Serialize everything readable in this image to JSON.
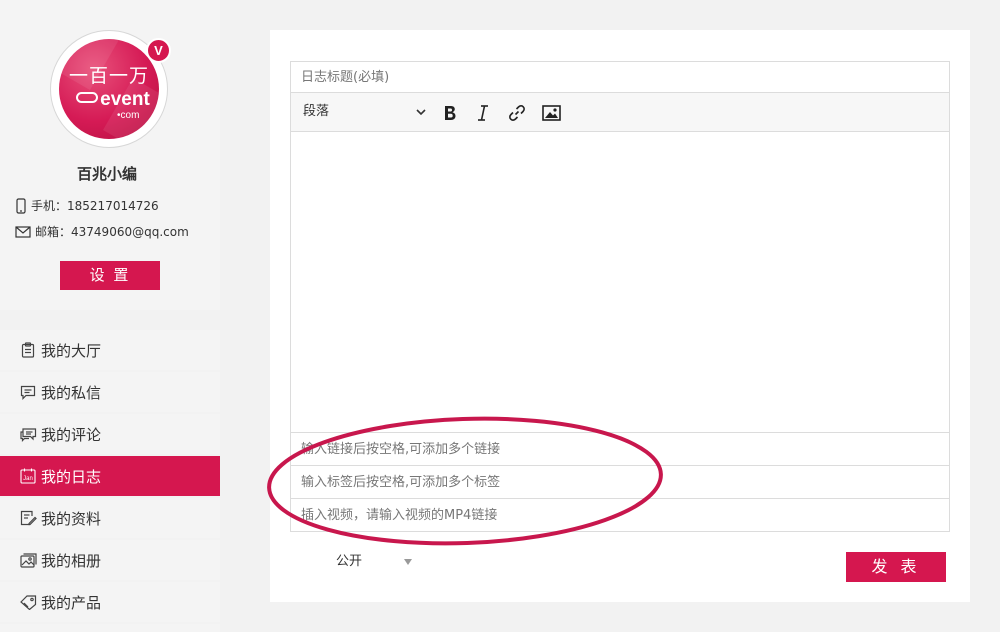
{
  "profile": {
    "logo_cn": "一百一万",
    "logo_event": "event",
    "logo_com": "•com",
    "badge": "V",
    "username": "百兆小编",
    "phone_label": "手机：",
    "phone": "185217014726",
    "email_label": "邮箱：",
    "email": "43749060@qq.com",
    "settings_label": "设 置"
  },
  "nav": {
    "items": [
      {
        "label": "我的大厅",
        "icon": "clipboard-icon"
      },
      {
        "label": "我的私信",
        "icon": "message-icon"
      },
      {
        "label": "我的评论",
        "icon": "comment-icon"
      },
      {
        "label": "我的日志",
        "icon": "calendar-icon",
        "icon_text": "Jan",
        "active": true
      },
      {
        "label": "我的资料",
        "icon": "profile-edit-icon"
      },
      {
        "label": "我的相册",
        "icon": "album-icon"
      },
      {
        "label": "我的产品",
        "icon": "product-tag-icon"
      }
    ]
  },
  "editor": {
    "title_placeholder": "日志标题(必填)",
    "paragraph_label": "段落",
    "links_placeholder": "输入链接后按空格,可添加多个链接",
    "tags_placeholder": "输入标签后按空格,可添加多个标签",
    "video_placeholder": "插入视频，请输入视频的MP4链接",
    "visibility_value": "公开",
    "publish_label": "发 表"
  },
  "colors": {
    "accent": "#d5174f",
    "annotation": "#c8174d"
  }
}
